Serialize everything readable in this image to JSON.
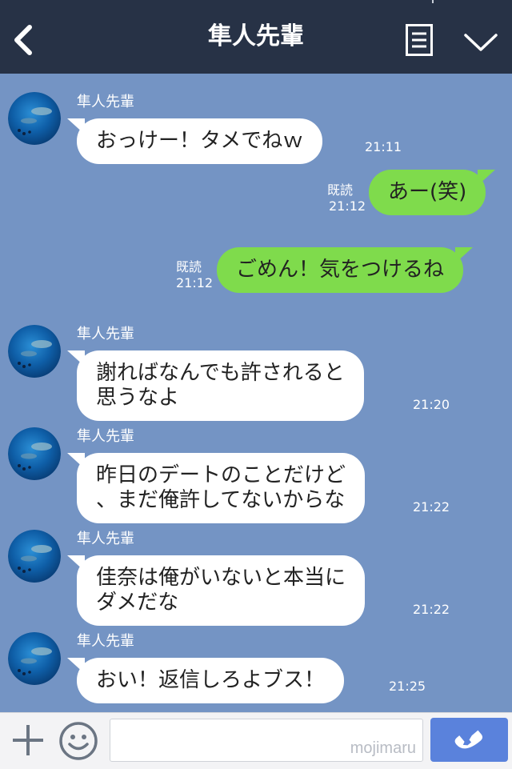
{
  "header": {
    "title": "隼人先輩",
    "icons": {
      "back": "chevron-left-icon",
      "menu": "note-menu-icon",
      "collapse": "chevron-down-icon"
    }
  },
  "messages": [
    {
      "from": "other",
      "sender": "隼人先輩",
      "text": "おっけー！タメでねｗ",
      "time": "21:11"
    },
    {
      "from": "me",
      "read": "既読",
      "text": "あー(笑)",
      "time": "21:12"
    },
    {
      "from": "me",
      "read": "既読",
      "text": "ごめん！気をつけるね",
      "time": "21:12"
    },
    {
      "from": "other",
      "sender": "隼人先輩",
      "text": "謝ればなんでも許されると\n思うなよ",
      "time": "21:20"
    },
    {
      "from": "other",
      "sender": "隼人先輩",
      "text": "昨日のデートのことだけど\n、まだ俺許してないからな",
      "time": "21:22"
    },
    {
      "from": "other",
      "sender": "隼人先輩",
      "text": "佳奈は俺がいないと本当に\nダメだな",
      "time": "21:22"
    },
    {
      "from": "other",
      "sender": "隼人先輩",
      "text": "おい！返信しろよブス！",
      "time": "21:25"
    }
  ],
  "input_bar": {
    "watermark": "mojimaru",
    "icons": {
      "add": "plus-icon",
      "sticker": "smiley-icon",
      "call": "phone-icon"
    }
  },
  "colors": {
    "header_bg": "#273246",
    "chat_bg": "#7494c4",
    "my_bubble": "#7fdb4c",
    "other_bubble": "#ffffff",
    "call_button": "#5a82dc"
  }
}
